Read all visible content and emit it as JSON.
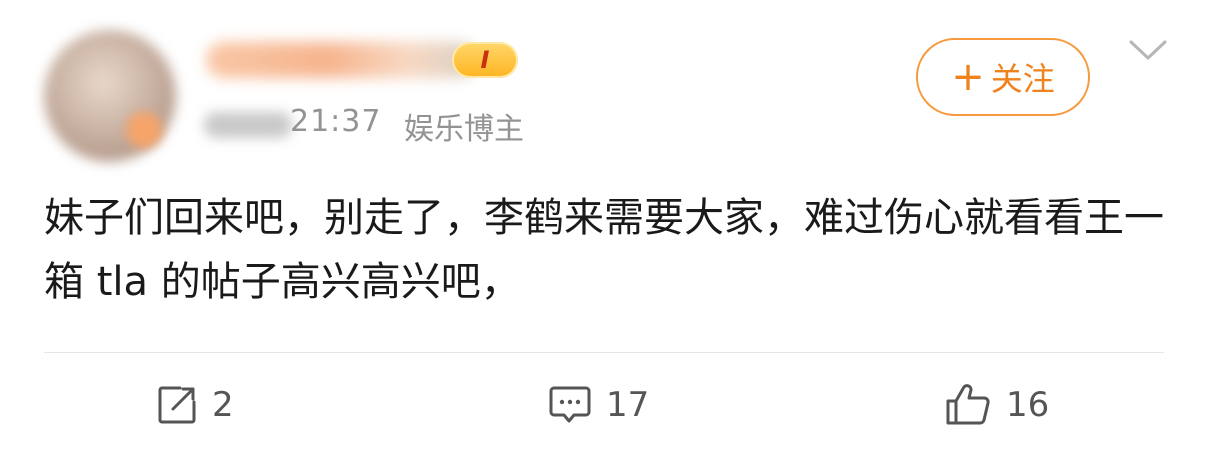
{
  "header": {
    "vip_label": "I",
    "time": "21:37",
    "author_tag": "娱乐博主",
    "follow_label": "关注",
    "follow_prefix": "+"
  },
  "post": {
    "text": "妹子们回来吧，别走了，李鹤来需要大家，难过伤心就看看王一箱 tla 的帖子高兴高兴吧，"
  },
  "actions": {
    "share_count": "2",
    "comment_count": "17",
    "like_count": "16"
  },
  "icons": {
    "share": "share-icon",
    "comment": "comment-icon",
    "like": "thumbs-up-icon",
    "more": "chevron-down-icon"
  },
  "colors": {
    "accent": "#f0821e",
    "follow_border": "#f59a3f",
    "muted": "#939393",
    "text": "#1a1a1a"
  }
}
